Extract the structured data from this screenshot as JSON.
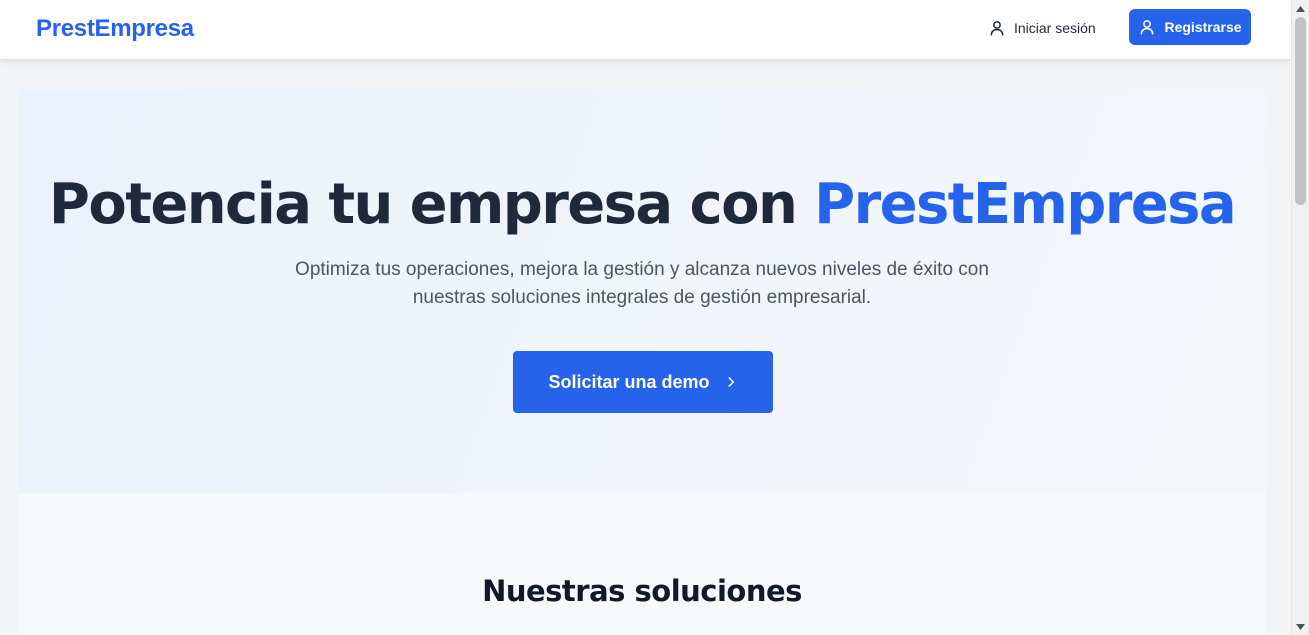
{
  "header": {
    "logo": "PrestEmpresa",
    "login_label": "Iniciar sesión",
    "register_label": "Registrarse",
    "login_icon": "user-icon",
    "register_icon": "user-icon"
  },
  "hero": {
    "title_prefix": "Potencia tu empresa con",
    "title_brand": "PrestEmpresa",
    "subtitle": "Optimiza tus operaciones, mejora la gestión y alcanza nuevos niveles de éxito con nuestras soluciones integrales de gestión empresarial.",
    "cta_label": "Solicitar una demo",
    "cta_icon": "chevron-right-icon"
  },
  "solutions": {
    "title": "Nuestras soluciones"
  },
  "colors": {
    "primary": "#2563eb",
    "heading": "#1e293b",
    "body_text": "#4b5563",
    "hero_bg": "#eaf2fd"
  }
}
